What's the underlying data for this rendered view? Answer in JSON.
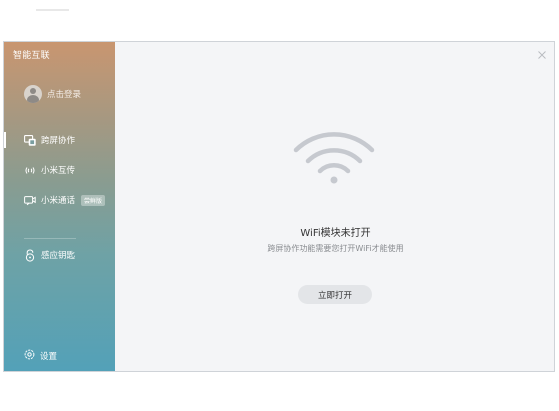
{
  "app": {
    "title": "智能互联"
  },
  "user": {
    "login_label": "点击登录"
  },
  "nav": {
    "items": [
      {
        "label": "跨屏协作",
        "icon": "screen-share-icon",
        "active": true
      },
      {
        "label": "小米互传",
        "icon": "transfer-waves-icon",
        "active": false
      },
      {
        "label": "小米通话",
        "icon": "video-call-icon",
        "active": false,
        "badge": "尝鲜版"
      }
    ],
    "secondary": [
      {
        "label": "感应钥匙",
        "icon": "lock-icon"
      }
    ],
    "settings_label": "设置"
  },
  "main": {
    "status_title": "WiFi模块未打开",
    "status_desc": "跨屏协作功能需要您打开WiFi才能使用",
    "button_label": "立即打开",
    "icon": "wifi-icon"
  },
  "colors": {
    "sidebar_top": "#c99670",
    "sidebar_bottom": "#53a1b8",
    "wifi_icon": "#c6c9cf",
    "button_bg": "#e3e5e8",
    "content_bg": "#f4f5f7"
  }
}
